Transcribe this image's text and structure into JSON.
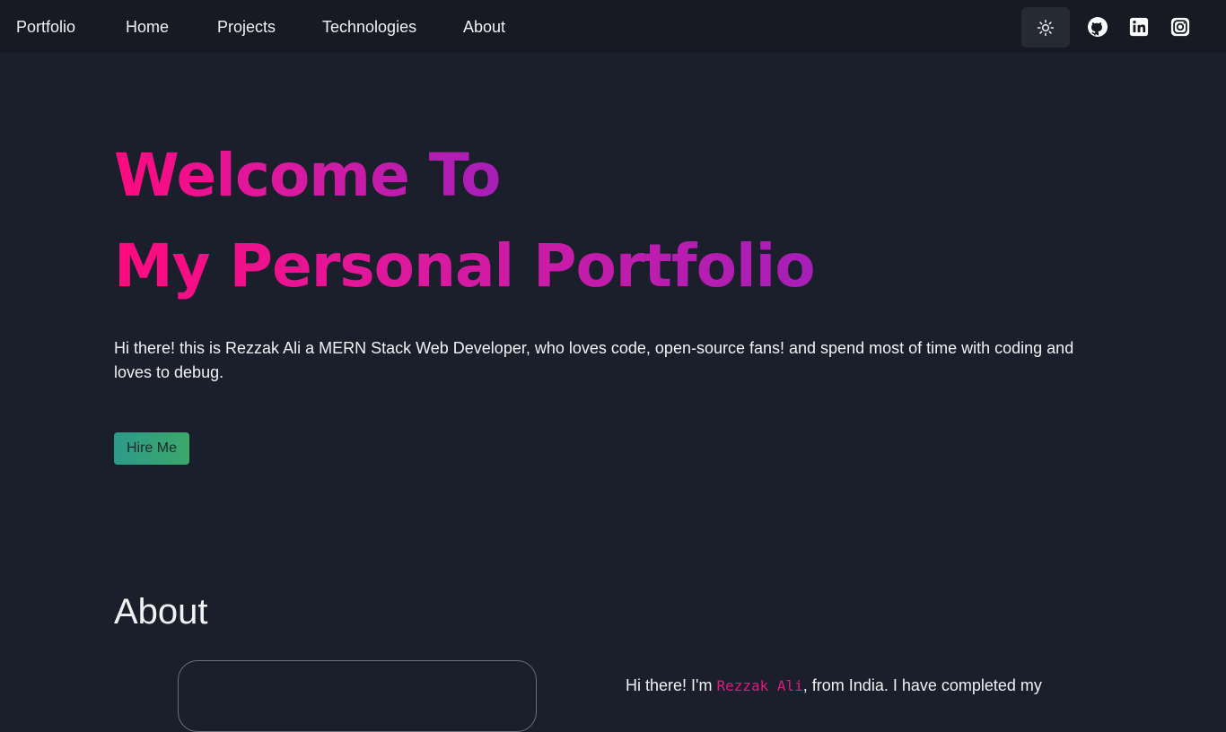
{
  "nav": {
    "brand": "Portfolio",
    "links": [
      "Home",
      "Projects",
      "Technologies",
      "About"
    ]
  },
  "icons": {
    "theme": "sun-icon",
    "github": "github-icon",
    "linkedin": "linkedin-icon",
    "instagram": "instagram-icon"
  },
  "hero": {
    "title_line1": "Welcome To",
    "title_line2": "My Personal Portfolio",
    "intro": "Hi there! this is Rezzak Ali a MERN Stack Web Developer, who loves code, open-source fans! and spend most of time with coding and loves to debug.",
    "hire_label": "Hire Me"
  },
  "about": {
    "heading": "About",
    "text_before": "Hi there! I'm ",
    "name": "Rezzak Ali",
    "text_after": ", from India. I have completed my"
  },
  "colors": {
    "background": "#1b1f2b",
    "navbar": "#171a23",
    "gradient_start": "#ff0a7e",
    "gradient_end": "#a61fb8",
    "button_start": "#2c9a8a",
    "button_end": "#3ca86a"
  }
}
